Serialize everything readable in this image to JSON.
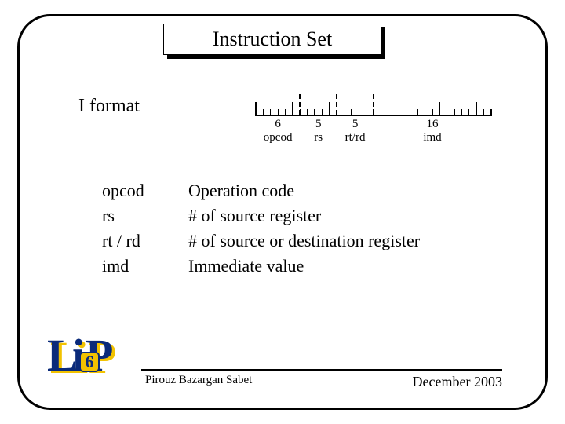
{
  "title": "Instruction Set",
  "format_label": "I format",
  "ruler": {
    "total_bits": 32,
    "fields": [
      {
        "bits": "6",
        "name": "opcod",
        "start": 0,
        "width": 6
      },
      {
        "bits": "5",
        "name": "rs",
        "start": 6,
        "width": 5
      },
      {
        "bits": "5",
        "name": "rt/rd",
        "start": 11,
        "width": 5
      },
      {
        "bits": "16",
        "name": "imd",
        "start": 16,
        "width": 16
      }
    ],
    "boundaries": [
      6,
      11,
      16
    ]
  },
  "definitions": [
    {
      "term": "opcod",
      "desc": "Operation code"
    },
    {
      "term": "rs",
      "desc": "# of source register"
    },
    {
      "term": "rt / rd",
      "desc": "# of source or destination register"
    },
    {
      "term": "imd",
      "desc": "Immediate value"
    }
  ],
  "footer": {
    "author": "Pirouz Bazargan Sabet",
    "date": "December 2003"
  },
  "logo": {
    "text_l": "L",
    "text_i": "i",
    "text_p": "P",
    "badge": "6"
  }
}
